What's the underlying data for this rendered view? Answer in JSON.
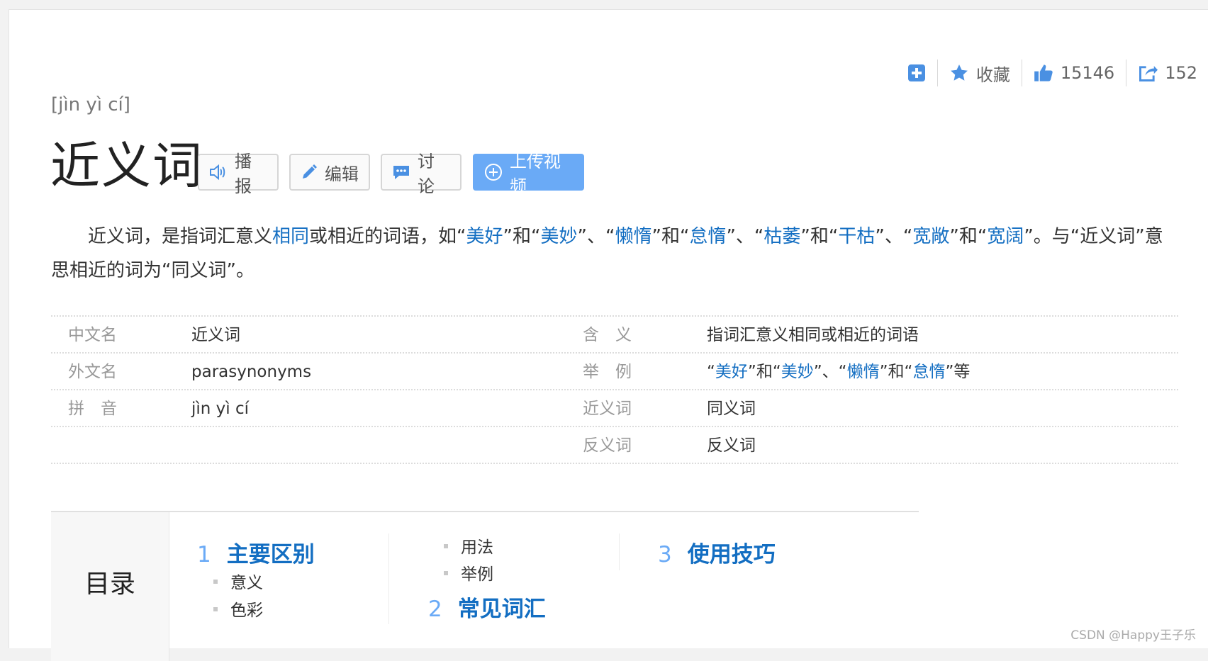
{
  "tools": {
    "favorite": "收藏",
    "likes": "15146",
    "shares": "152"
  },
  "pinyin": "[jìn yì cí]",
  "title": "近义词",
  "actions": {
    "broadcast": "播报",
    "edit": "编辑",
    "discuss": "讨论",
    "upload_video": "上传视频"
  },
  "summary": {
    "p1": "近义词，是指词汇意义",
    "l1": "相同",
    "p2": "或相近的词语，如“",
    "l2": "美好",
    "p3": "”和“",
    "l3": "美妙",
    "p4": "”、“",
    "l4": "懒惰",
    "p5": "”和“",
    "l5": "怠惰",
    "p6": "”、“",
    "l6": "枯萎",
    "p7": "”和“",
    "l7": "干枯",
    "p8": "”、“",
    "l8": "宽敞",
    "p9": "”和“",
    "l9": "宽阔",
    "p10": "”。与“近义词”意思相近的词为“同义词”。"
  },
  "info": {
    "r1": {
      "k1": "中文名",
      "v1": "近义词",
      "k2": "含　义",
      "v2": "指词汇意义相同或相近的词语"
    },
    "r2": {
      "k1": "外文名",
      "v1": "parasynonyms",
      "k2": "举　例",
      "e1": "“",
      "el1": "美好",
      "e2": "”和“",
      "el2": "美妙",
      "e3": "”、“",
      "el3": "懒惰",
      "e4": "”和“",
      "el4": "怠惰",
      "e5": "”等"
    },
    "r3": {
      "k1": "拼　音",
      "v1": "jìn yì cí",
      "k2": "近义词",
      "v2": "同义词"
    },
    "r4": {
      "k2": "反义词",
      "v2": "反义词"
    }
  },
  "toc": {
    "title": "目录",
    "s1": {
      "num": "1",
      "label": "主要区别",
      "sub1": "意义",
      "sub2": "色彩",
      "sub3": "用法",
      "sub4": "举例"
    },
    "s2": {
      "num": "2",
      "label": "常见词汇"
    },
    "s3": {
      "num": "3",
      "label": "使用技巧"
    }
  },
  "watermark": "CSDN @Happy王子乐",
  "colors": {
    "link": "#136ec2",
    "accent": "#6aaaf6",
    "toolIcon": "#4a90e2"
  }
}
